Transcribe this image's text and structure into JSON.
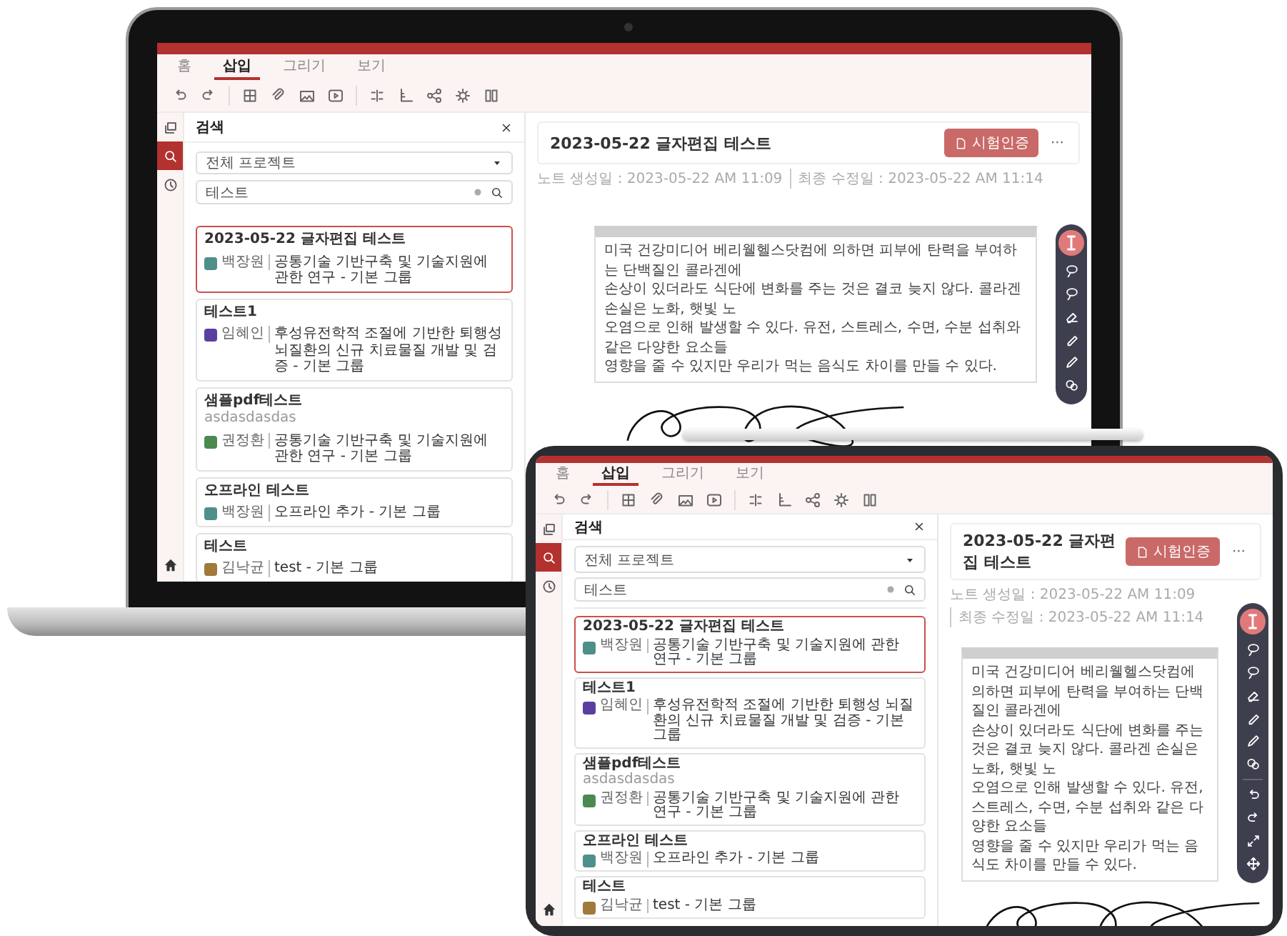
{
  "laptop": {
    "screen": {
      "menu_tabs": [
        {
          "label": "홈",
          "selected": false
        },
        {
          "label": "삽입",
          "selected": true
        },
        {
          "label": "그리기",
          "selected": false
        },
        {
          "label": "보기",
          "selected": false
        }
      ],
      "rail": [
        {
          "kind": "pages",
          "selected": false
        },
        {
          "kind": "search",
          "selected": true
        },
        {
          "kind": "history",
          "selected": false
        }
      ],
      "panel": {
        "title": "검색",
        "project_select": {
          "value": "전체 프로젝트"
        },
        "search": {
          "value": "테스트"
        },
        "results": [
          {
            "title": "2023-05-22 글자편집 테스트",
            "author": "백장원",
            "color": "#4f8f8a",
            "project": "공통기술 기반구축 및 기술지원에 관한 연구 - 기본 그룹",
            "selected": true
          },
          {
            "title": "테스트1",
            "author": "임혜인",
            "color": "#5b3fa0",
            "project": "후성유전학적 조절에 기반한 퇴행성 뇌질환의 신규 치료물질 개발 및 검증 - 기본 그룹",
            "selected": false
          },
          {
            "title": "샘플pdf테스트",
            "description": "asdasdasdas",
            "author": "권정환",
            "color": "#4a8a50",
            "project": "공통기술 기반구축 및 기술지원에 관한 연구 - 기본 그룹",
            "selected": false
          },
          {
            "title": "오프라인 테스트",
            "author": "백장원",
            "color": "#4f8f8a",
            "project": "오프라인 추가 - 기본 그룹",
            "selected": false
          },
          {
            "title": "테스트",
            "author": "김낙균",
            "color": "#a07a3a",
            "project": "test - 기본 그룹",
            "selected": false
          }
        ]
      },
      "note": {
        "title": "2023-05-22 글자편집 테스트",
        "button": "시험인증",
        "more": "···",
        "created": "노트 생성일 : 2023-05-22 AM 11:09",
        "modified": "최종 수정일 : 2023-05-22 AM 11:14",
        "text_lines": [
          "미국 건강미디어 베리웰헬스닷컴에 의하면 피부에 탄력을 부여하는 단백질인 콜라겐에",
          "손상이 있더라도 식단에 변화를 주는 것은 결코 늦지 않다. 콜라겐 손실은 노화, 햇빛 노",
          "오염으로 인해 발생할 수 있다. 유전, 스트레스, 수면, 수분 섭취와 같은 다양한 요소들",
          "영향을 줄 수 있지만 우리가 먹는 음식도 차이를 만들 수 있다."
        ]
      },
      "drawing_tools": [
        {
          "kind": "text"
        },
        {
          "kind": "lasso"
        },
        {
          "kind": "lasso"
        },
        {
          "kind": "eraser"
        },
        {
          "kind": "marker"
        },
        {
          "kind": "pen"
        },
        {
          "kind": "shapes"
        }
      ]
    }
  },
  "tablet": {
    "screen": {
      "menu_tabs": [
        {
          "label": "홈",
          "selected": false
        },
        {
          "label": "삽입",
          "selected": true
        },
        {
          "label": "그리기",
          "selected": false
        },
        {
          "label": "보기",
          "selected": false
        }
      ],
      "rail": [
        {
          "kind": "pages",
          "selected": false
        },
        {
          "kind": "search",
          "selected": true
        },
        {
          "kind": "history",
          "selected": false
        }
      ],
      "panel": {
        "title": "검색",
        "project_select": {
          "value": "전체 프로젝트"
        },
        "search": {
          "value": "테스트"
        },
        "results": [
          {
            "title": "2023-05-22 글자편집 테스트",
            "author": "백장원",
            "color": "#4f8f8a",
            "project": "공통기술 기반구축 및 기술지원에 관한 연구 - 기본 그룹",
            "selected": true
          },
          {
            "title": "테스트1",
            "author": "임혜인",
            "color": "#5b3fa0",
            "project": "후성유전학적 조절에 기반한 퇴행성 뇌질환의 신규 치료물질 개발 및 검증 - 기본 그룹",
            "selected": false
          },
          {
            "title": "샘플pdf테스트",
            "description": "asdasdasdas",
            "author": "권정환",
            "color": "#4a8a50",
            "project": "공통기술 기반구축 및 기술지원에 관한 연구 - 기본 그룹",
            "selected": false
          },
          {
            "title": "오프라인 테스트",
            "author": "백장원",
            "color": "#4f8f8a",
            "project": "오프라인 추가 - 기본 그룹",
            "selected": false
          },
          {
            "title": "테스트",
            "author": "김낙균",
            "color": "#a07a3a",
            "project": "test - 기본 그룹",
            "selected": false
          }
        ]
      },
      "note": {
        "title": "2023-05-22 글자편집 테스트",
        "button": "시험인증",
        "more": "···",
        "created": "노트 생성일 : 2023-05-22 AM 11:09",
        "modified": "최종 수정일 : 2023-05-22 AM 11:14",
        "text_lines": [
          "미국 건강미디어 베리웰헬스닷컴에 의하면 피부에 탄력을 부여하는 단백질인 콜라겐에",
          "손상이 있더라도 식단에 변화를 주는 것은 결코 늦지 않다. 콜라겐 손실은 노화, 햇빛 노",
          "오염으로 인해 발생할 수 있다. 유전, 스트레스, 수면, 수분 섭취와 같은 다양한 요소들",
          "영향을 줄 수 있지만 우리가 먹는 음식도 차이를 만들 수 있다."
        ]
      },
      "drawing_tools": [
        {
          "kind": "text"
        },
        {
          "kind": "lasso"
        },
        {
          "kind": "lasso"
        },
        {
          "kind": "eraser"
        },
        {
          "kind": "marker"
        },
        {
          "kind": "pen"
        },
        {
          "kind": "shapes"
        },
        {
          "kind": "divider"
        },
        {
          "kind": "undo"
        },
        {
          "kind": "redo"
        },
        {
          "kind": "scale"
        },
        {
          "kind": "move"
        }
      ]
    }
  }
}
